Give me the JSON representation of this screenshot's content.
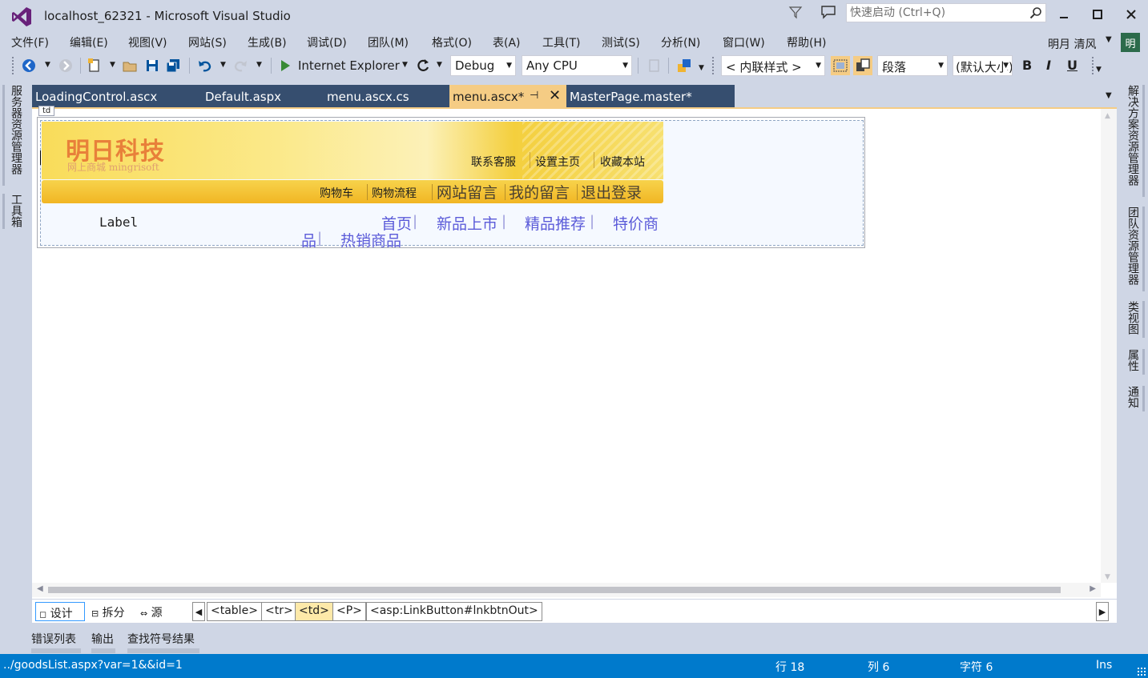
{
  "window": {
    "title": "localhost_62321 - Microsoft Visual Studio",
    "quick_launch_placeholder": "快速启动 (Ctrl+Q)",
    "minimize_glyph": "—",
    "maximize_glyph": "☐",
    "close_glyph": "✕"
  },
  "menu": {
    "items": [
      "文件(F)",
      "编辑(E)",
      "视图(V)",
      "网站(S)",
      "生成(B)",
      "调试(D)",
      "团队(M)",
      "格式(O)",
      "表(A)",
      "工具(T)",
      "测试(S)",
      "分析(N)",
      "窗口(W)",
      "帮助(H)"
    ],
    "user_name": "明月 清风",
    "user_avatar": "明"
  },
  "toolbar": {
    "browser": "Internet Explorer",
    "config": "Debug",
    "platform": "Any CPU",
    "style_target": "< 内联样式 >",
    "block_format": "段落",
    "font_size": "(默认大小)",
    "bold": "B",
    "italic": "I",
    "underline": "U"
  },
  "left_tools": [
    "服务器资源管理器",
    "工具箱"
  ],
  "right_tools": [
    "解决方案资源管理器",
    "团队资源管理器",
    "类视图",
    "属性",
    "通知"
  ],
  "tabs": [
    {
      "label": "LoadingControl.ascx",
      "active": false
    },
    {
      "label": "Default.aspx",
      "active": false
    },
    {
      "label": "menu.ascx.cs",
      "active": false
    },
    {
      "label": "menu.ascx*",
      "active": true
    },
    {
      "label": "MasterPage.master*",
      "active": false
    }
  ],
  "designer": {
    "element_tag": "td",
    "brand_name": "明日科技",
    "brand_sub": "网上商城 mingrisoft",
    "top_links": [
      "联系客服",
      "设置主页",
      "收藏本站"
    ],
    "nav_small": [
      "购物车",
      "购物流程"
    ],
    "nav_large": [
      "网站留言",
      "我的留言",
      "退出登录"
    ],
    "label": "Label",
    "categories_line1": [
      "首页",
      "新品上市",
      "精品推荐",
      "特价商"
    ],
    "categories_line2": [
      "品",
      "热销商品"
    ],
    "separator": "|"
  },
  "viewbar": {
    "views": [
      {
        "label": "设计",
        "icon": "design-view-icon",
        "active": true
      },
      {
        "label": "拆分",
        "icon": "split-view-icon",
        "active": false
      },
      {
        "label": "源",
        "icon": "source-view-icon",
        "active": false
      }
    ],
    "breadcrumb": [
      "<table>",
      "<tr>",
      "<td>",
      "<P>",
      "<asp:LinkButton#lnkbtnOut>"
    ],
    "selected_crumb": "<td>"
  },
  "output_tabs": [
    "错误列表",
    "输出",
    "查找符号结果"
  ],
  "status": {
    "message": "../goodsList.aspx?var=1&&id=1",
    "line": "行 18",
    "col": "列 6",
    "char": "字符 6",
    "mode": "Ins"
  },
  "colors": {
    "accent": "#007acc",
    "active_tab": "#f5cc84",
    "inactive_tab": "#364e6f",
    "chrome": "#cfd6e5",
    "vs_purple": "#68217a"
  }
}
